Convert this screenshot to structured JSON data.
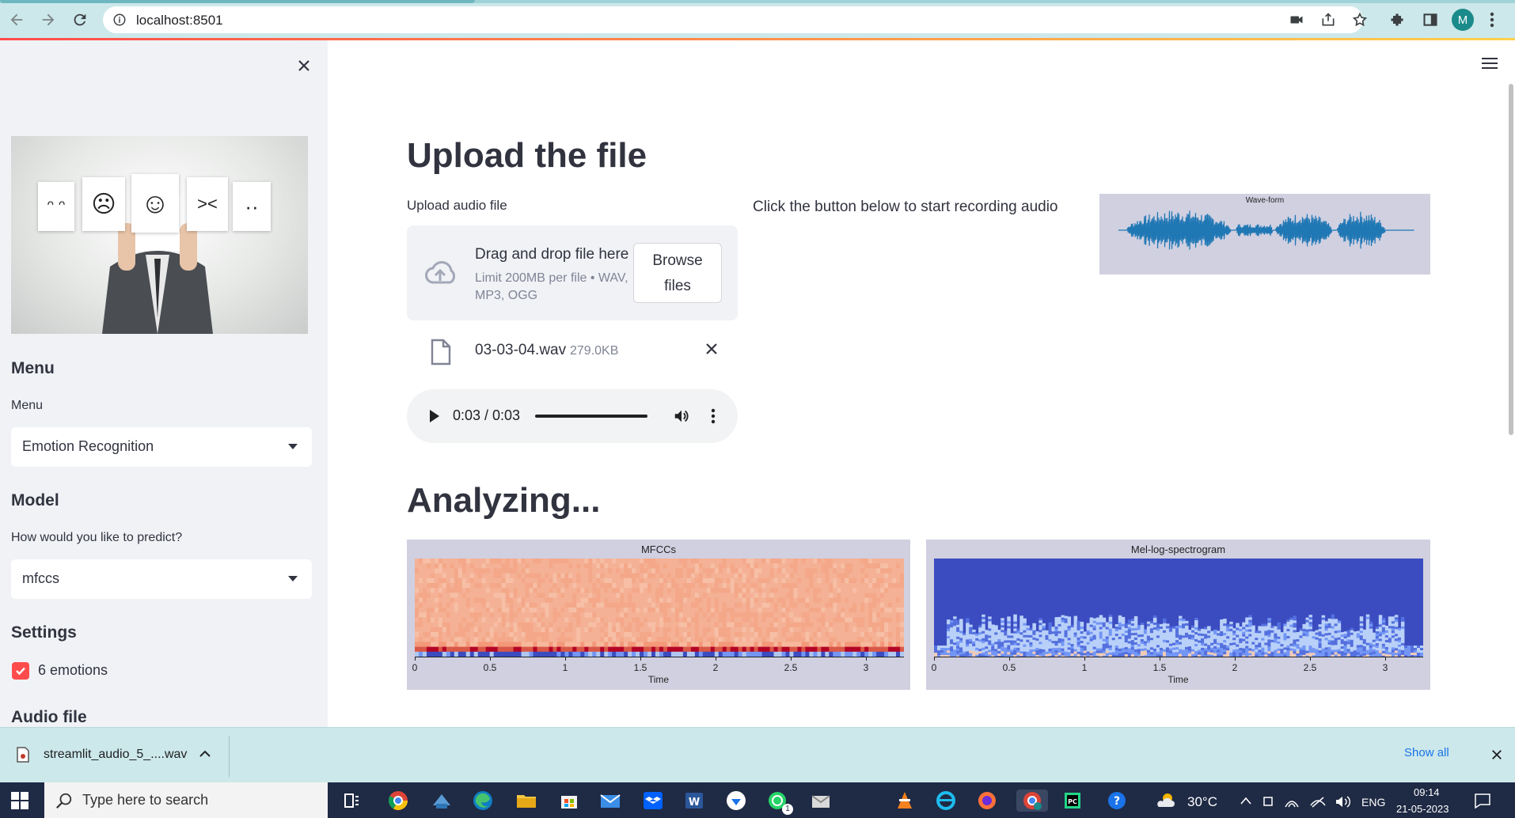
{
  "browser": {
    "url": "localhost:8501",
    "avatar_letter": "M"
  },
  "sidebar": {
    "menu_heading": "Menu",
    "menu_label": "Menu",
    "menu_selected": "Emotion Recognition",
    "model_heading": "Model",
    "model_label": "How would you like to predict?",
    "model_selected": "mfccs",
    "settings_heading": "Settings",
    "checkbox_label": "6 emotions",
    "checkbox_checked": true,
    "audio_heading": "Audio file"
  },
  "main": {
    "upload_title": "Upload the file",
    "upload_label": "Upload audio file",
    "dropzone_title": "Drag and drop file here",
    "dropzone_limit": "Limit 200MB per file • WAV, MP3, OGG",
    "browse_label_1": "Browse",
    "browse_label_2": "files",
    "file_name": "03-03-04.wav",
    "file_size": "279.0KB",
    "audio_time": "0:03 / 0:03",
    "audio_progress": 1.0,
    "record_text": "Click the button below to start recording audio",
    "waveform_title": "Wave-form",
    "analyzing_title": "Analyzing..."
  },
  "plots": {
    "mfcc_title": "MFCCs",
    "mel_title": "Mel-log-spectrogram",
    "xlabel": "Time",
    "xticks": [
      "0",
      "0.5",
      "1",
      "1.5",
      "2",
      "2.5",
      "3"
    ]
  },
  "download": {
    "file_name": "streamlit_audio_5_....wav",
    "show_all": "Show all"
  },
  "taskbar": {
    "search_placeholder": "Type here to search",
    "weather": "30°C",
    "language": "ENG",
    "time": "09:14",
    "date": "21-05-2023",
    "whatsapp_badge": "1"
  }
}
